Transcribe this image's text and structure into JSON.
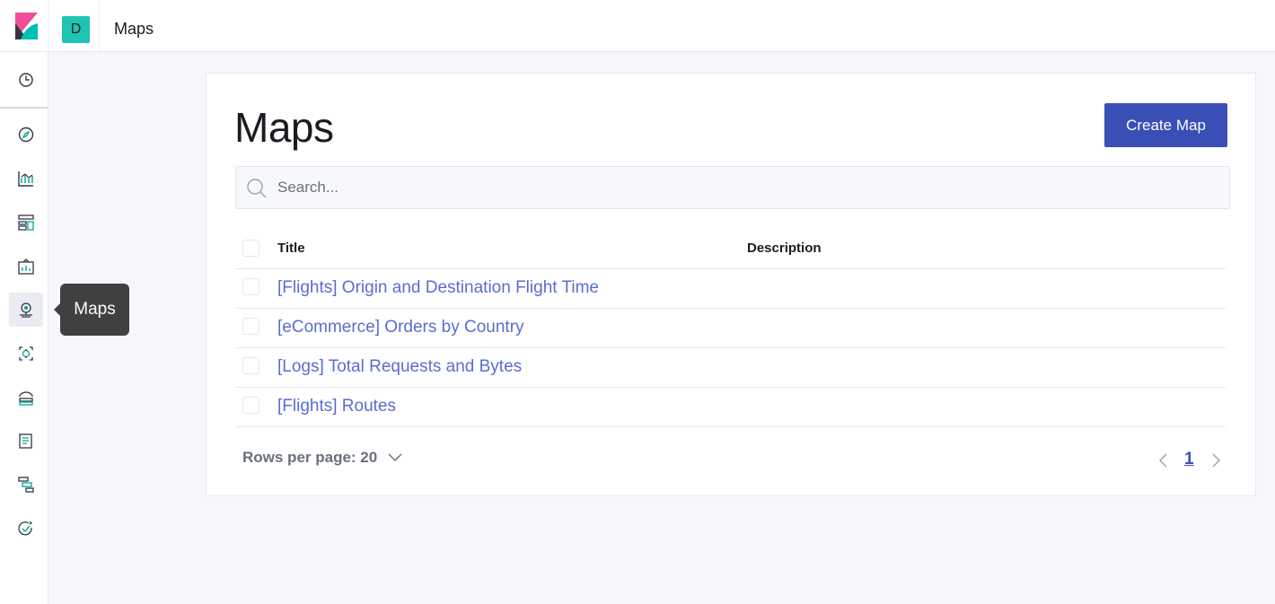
{
  "header": {
    "space_initial": "D",
    "breadcrumb": "Maps"
  },
  "sidebar": {
    "items": [
      {
        "name": "clock-icon"
      },
      {
        "name": "compass-icon"
      },
      {
        "name": "visualize-icon"
      },
      {
        "name": "dashboard-icon"
      },
      {
        "name": "canvas-icon"
      },
      {
        "name": "maps-icon",
        "active": true
      },
      {
        "name": "ml-icon"
      },
      {
        "name": "infrastructure-icon"
      },
      {
        "name": "logs-icon"
      },
      {
        "name": "apm-icon"
      },
      {
        "name": "uptime-icon"
      }
    ],
    "tooltip": "Maps"
  },
  "main": {
    "title": "Maps",
    "create_button": "Create Map",
    "search_placeholder": "Search...",
    "columns": [
      "Title",
      "Description"
    ],
    "rows": [
      {
        "title": "[Flights] Origin and Destination Flight Time",
        "description": ""
      },
      {
        "title": "[eCommerce] Orders by Country",
        "description": ""
      },
      {
        "title": "[Logs] Total Requests and Bytes",
        "description": ""
      },
      {
        "title": "[Flights] Routes",
        "description": ""
      }
    ],
    "rows_per_page": "Rows per page: 20",
    "current_page": "1"
  },
  "colors": {
    "primary": "#3a4fb5",
    "link": "#5a6dd1",
    "space_avatar": "#1ec5b4"
  }
}
